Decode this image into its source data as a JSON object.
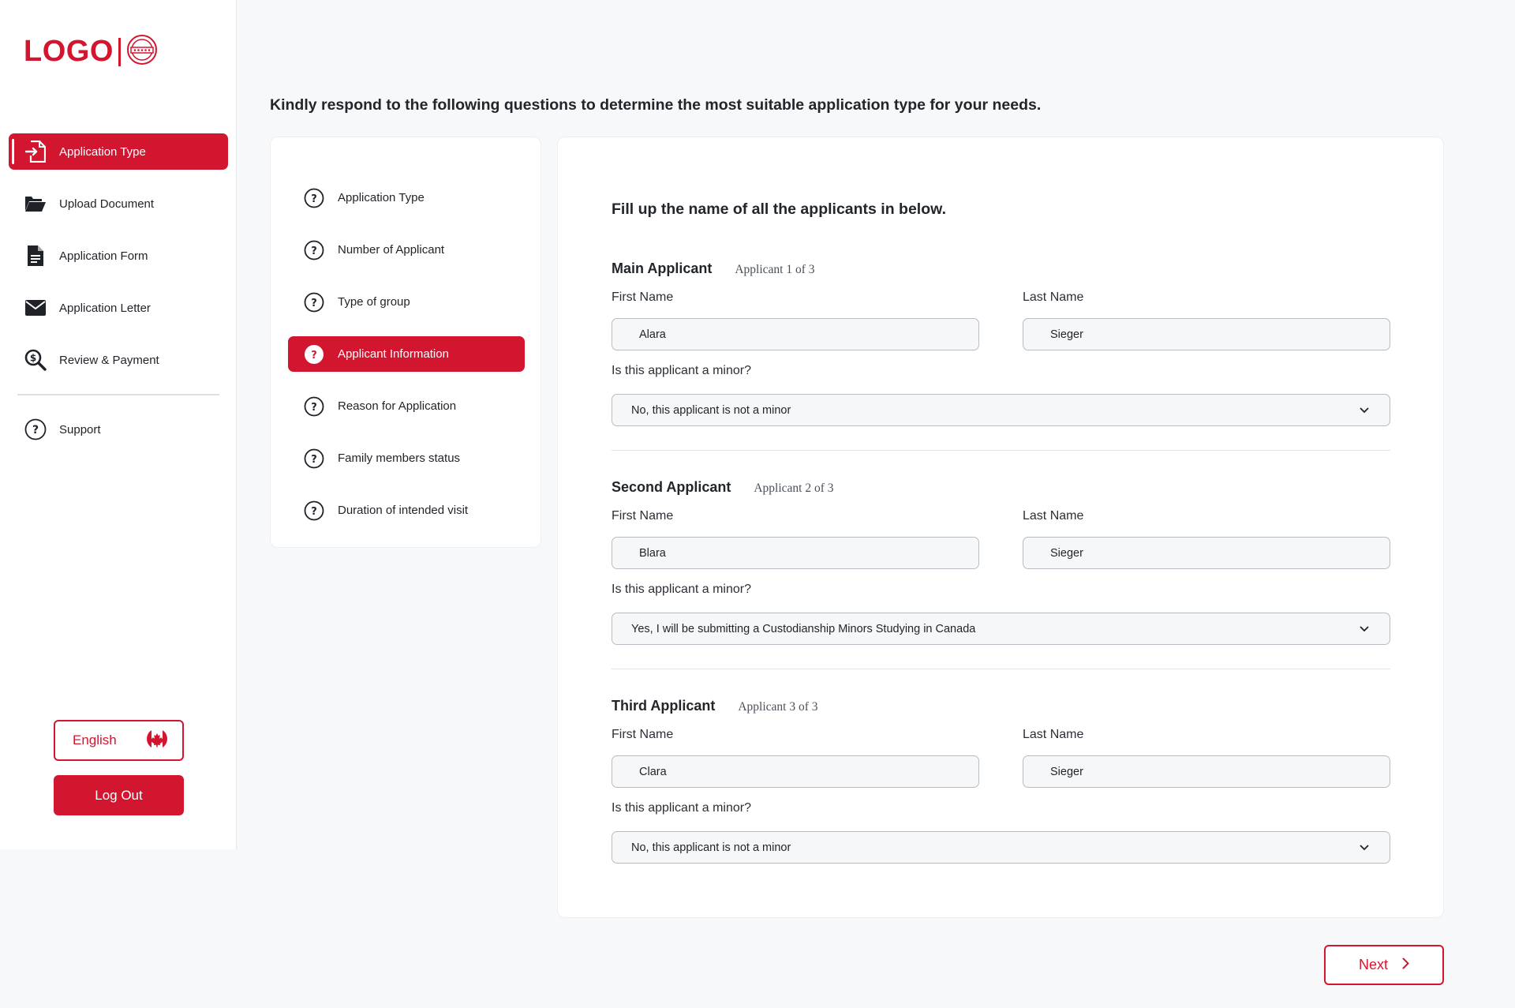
{
  "logo": {
    "text": "LOGO"
  },
  "sidebar": {
    "items": [
      {
        "label": "Application Type",
        "icon": "file-arrow-in-icon",
        "active": true
      },
      {
        "label": "Upload Document",
        "icon": "folder-open-icon",
        "active": false
      },
      {
        "label": "Application Form",
        "icon": "document-icon",
        "active": false
      },
      {
        "label": "Application Letter",
        "icon": "envelope-icon",
        "active": false
      },
      {
        "label": "Review & Payment",
        "icon": "dollar-search-icon",
        "active": false
      }
    ],
    "support_label": "Support",
    "language_label": "English",
    "logout_label": "Log Out"
  },
  "intro": "Kindly respond to the following questions to determine the most suitable application type for your needs.",
  "steps": [
    {
      "label": "Application Type",
      "active": false
    },
    {
      "label": "Number of Applicant",
      "active": false
    },
    {
      "label": "Type of group",
      "active": false
    },
    {
      "label": "Applicant Information",
      "active": true
    },
    {
      "label": "Reason for Application",
      "active": false
    },
    {
      "label": "Family members status",
      "active": false
    },
    {
      "label": "Duration of intended visit",
      "active": false
    }
  ],
  "form": {
    "title": "Fill up the name of all the applicants in below.",
    "first_name_label": "First Name",
    "last_name_label": "Last Name",
    "minor_question": "Is this applicant a minor?",
    "applicants": [
      {
        "heading": "Main Applicant",
        "counter": "Applicant 1 of 3",
        "first_name": "Alara",
        "last_name": "Sieger",
        "minor": "No, this applicant is not a minor"
      },
      {
        "heading": "Second Applicant",
        "counter": "Applicant 2 of 3",
        "first_name": "Blara",
        "last_name": "Sieger",
        "minor": "Yes, I will be submitting a Custodianship Minors Studying in Canada"
      },
      {
        "heading": "Third Applicant",
        "counter": "Applicant 3 of 3",
        "first_name": "Clara",
        "last_name": "Sieger",
        "minor": "No, this applicant is not a minor"
      }
    ]
  },
  "next_label": "Next",
  "colors": {
    "accent": "#d3162f",
    "background": "#f7f8fa",
    "card": "#ffffff"
  }
}
